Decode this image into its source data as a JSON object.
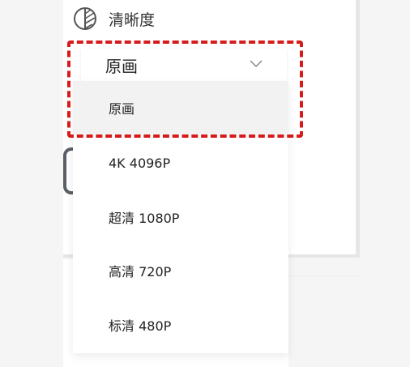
{
  "settings_section": {
    "title": "清晰度",
    "icon": "contrast-icon"
  },
  "quality_select": {
    "selected_value": "原画",
    "icon": "chevron-down-icon"
  },
  "quality_options": [
    {
      "label": "原画",
      "selected": true
    },
    {
      "label": "4K 4096P",
      "selected": false
    },
    {
      "label": "超清 1080P",
      "selected": false
    },
    {
      "label": "高清 720P",
      "selected": false
    },
    {
      "label": "标清 480P",
      "selected": false
    }
  ],
  "colors": {
    "highlight_border": "#d61b1b",
    "selected_option_bg": "#f2f2f2",
    "page_bg": "#f5f5f5",
    "panel_bg": "#ffffff"
  }
}
